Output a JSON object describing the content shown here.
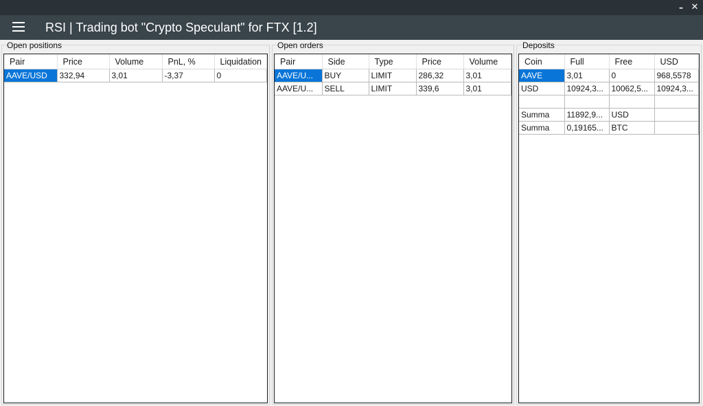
{
  "window": {
    "minimize_label": "–",
    "close_label": "✕"
  },
  "header": {
    "title": "RSI |  Trading bot \"Crypto Speculant\" for FTX [1.2]",
    "menu_icon": "hamburger-menu-icon"
  },
  "positions": {
    "label": "Open positions",
    "columns": [
      "Pair",
      "Price",
      "Volume",
      "PnL, %",
      "Liquidation"
    ],
    "rows": [
      [
        "AAVE/USD",
        "332,94",
        "3,01",
        "-3,37",
        "0"
      ]
    ]
  },
  "orders": {
    "label": "Open orders",
    "columns": [
      "Pair",
      "Side",
      "Type",
      "Price",
      "Volume"
    ],
    "rows": [
      [
        "AAVE/U...",
        "BUY",
        "LIMIT",
        "286,32",
        "3,01"
      ],
      [
        "AAVE/U...",
        "SELL",
        "LIMIT",
        "339,6",
        "3,01"
      ]
    ]
  },
  "deposits": {
    "label": "Deposits",
    "columns": [
      "Coin",
      "Full",
      "Free",
      "USD"
    ],
    "rows": [
      [
        "AAVE",
        "3,01",
        "0",
        "968,5578"
      ],
      [
        "USD",
        "10924,3...",
        "10062,5...",
        "10924,3..."
      ],
      [
        "",
        "",
        "",
        ""
      ],
      [
        "Summa",
        "11892,9...",
        "USD",
        ""
      ],
      [
        "Summa",
        "0,19165...",
        "BTC",
        ""
      ]
    ]
  },
  "colors": {
    "titlebar": "#2b3237",
    "header": "#39444b",
    "selection": "#0a75d8"
  }
}
